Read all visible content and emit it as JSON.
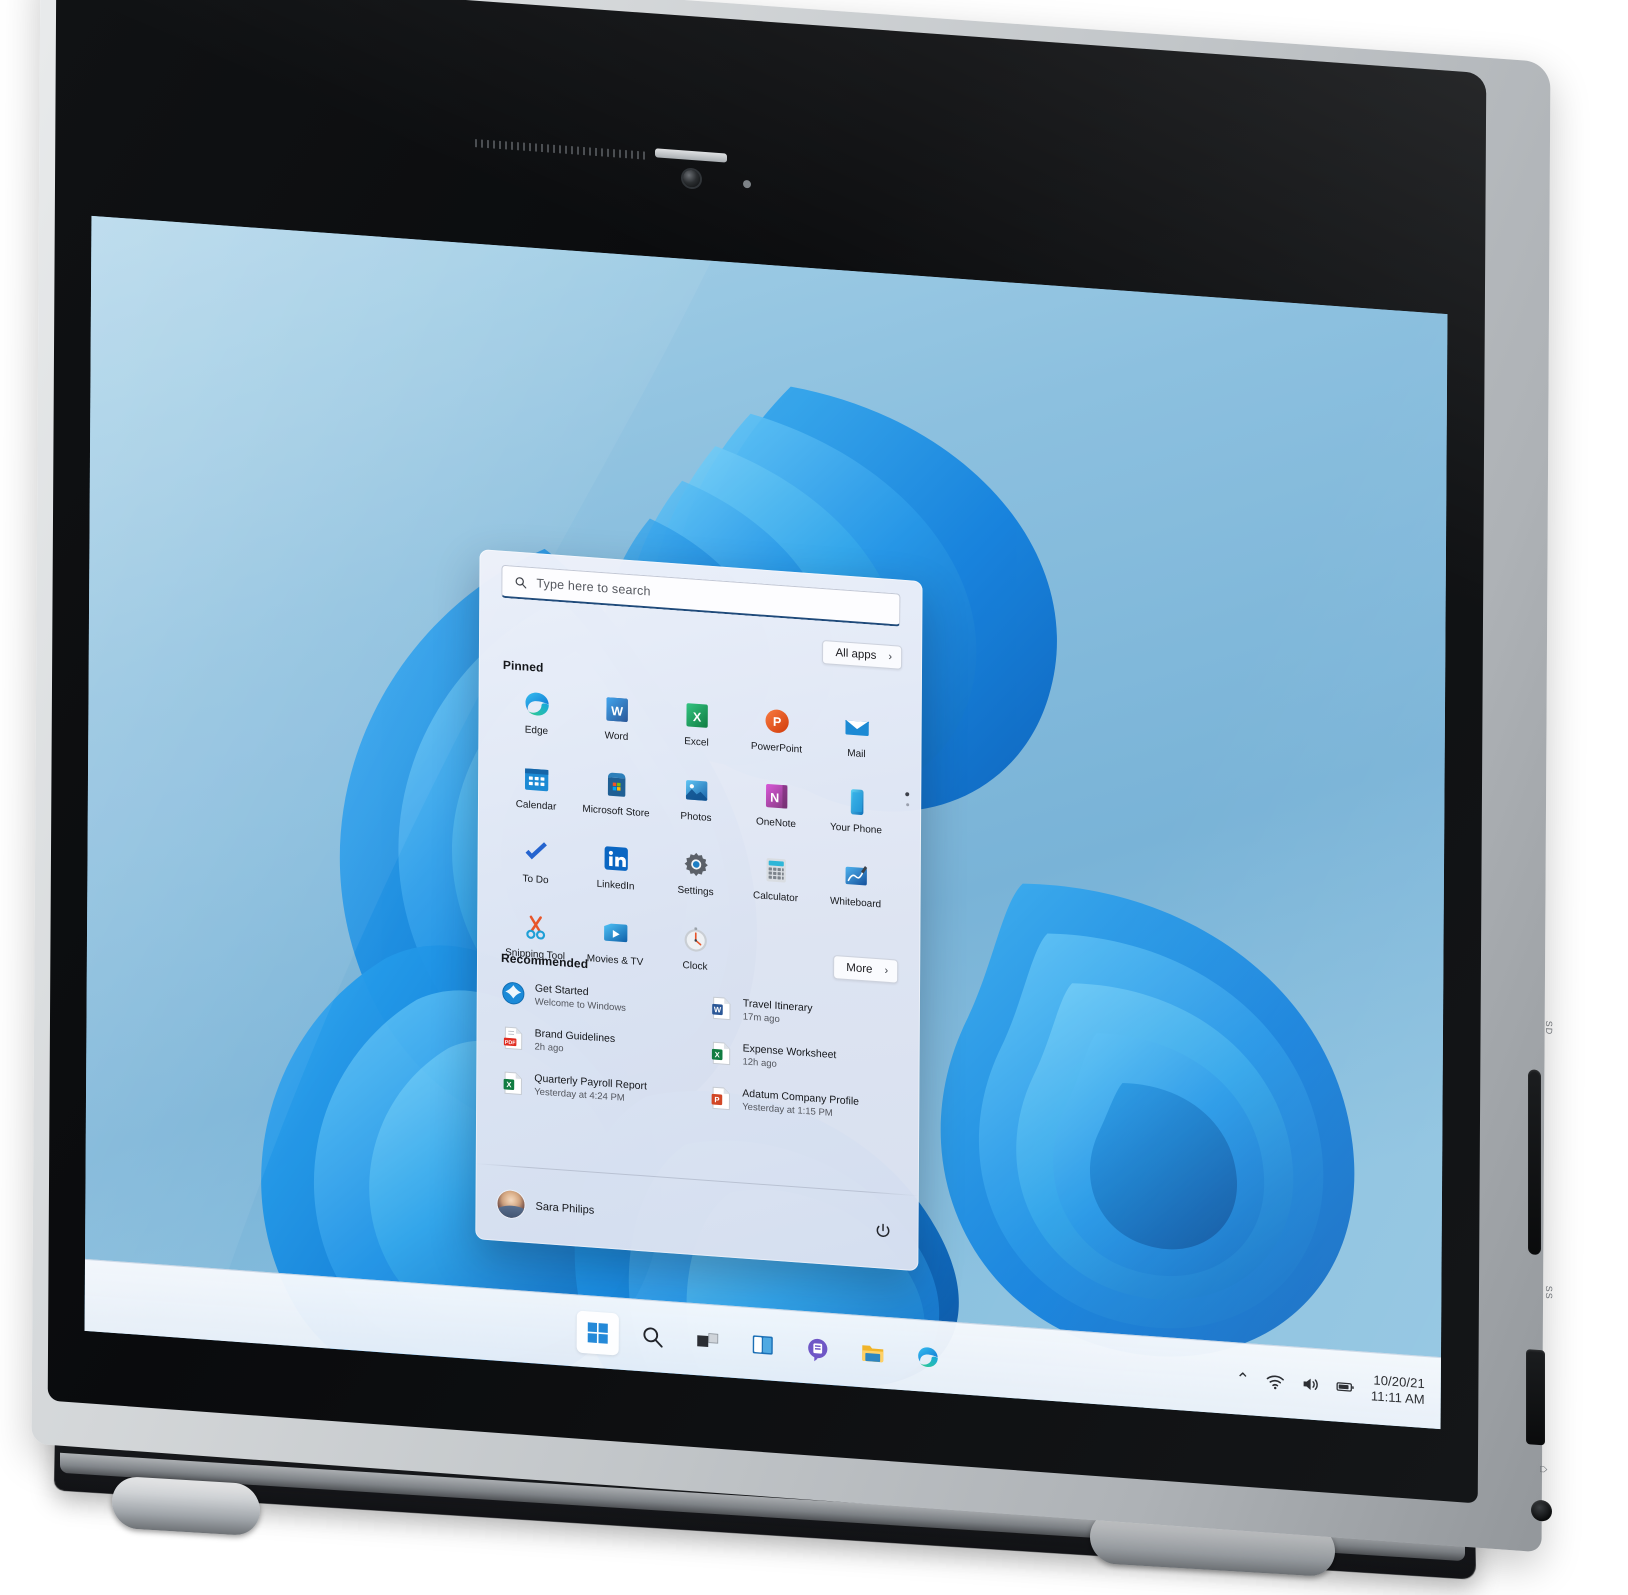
{
  "device": {
    "type": "2-in-1 convertible laptop",
    "ports": [
      {
        "name": "sd-card-slot",
        "label": "SD"
      },
      {
        "name": "usb-c-port",
        "label": "SS"
      },
      {
        "name": "headphone-jack",
        "label": "⌂"
      }
    ]
  },
  "desktop": {
    "wallpaper_name": "windows-11-bloom",
    "colors": {
      "wallpaper_sky": "#79b6d9",
      "bloom_blue": "#0a7bd6",
      "bloom_light": "#35a6ea",
      "accent": "#0067c0",
      "taskbar": "#eef3f9",
      "panel": "#e3e8f4"
    }
  },
  "start_menu": {
    "search": {
      "placeholder": "Type here to search",
      "value": "",
      "icon": "search-icon"
    },
    "all_apps_label": "All apps",
    "more_label": "More",
    "pinned_title": "Pinned",
    "recommended_title": "Recommended",
    "pinned": [
      {
        "label": "Edge",
        "icon": "edge-icon"
      },
      {
        "label": "Word",
        "icon": "word-icon"
      },
      {
        "label": "Excel",
        "icon": "excel-icon"
      },
      {
        "label": "PowerPoint",
        "icon": "powerpoint-icon"
      },
      {
        "label": "Mail",
        "icon": "mail-icon"
      },
      {
        "label": "Calendar",
        "icon": "calendar-icon"
      },
      {
        "label": "Microsoft Store",
        "icon": "microsoft-store-icon"
      },
      {
        "label": "Photos",
        "icon": "photos-icon"
      },
      {
        "label": "OneNote",
        "icon": "onenote-icon"
      },
      {
        "label": "Your Phone",
        "icon": "your-phone-icon"
      },
      {
        "label": "To Do",
        "icon": "to-do-icon"
      },
      {
        "label": "LinkedIn",
        "icon": "linkedin-icon"
      },
      {
        "label": "Settings",
        "icon": "settings-icon"
      },
      {
        "label": "Calculator",
        "icon": "calculator-icon"
      },
      {
        "label": "Whiteboard",
        "icon": "whiteboard-icon"
      },
      {
        "label": "Snipping Tool",
        "icon": "snipping-tool-icon"
      },
      {
        "label": "Movies & TV",
        "icon": "movies-tv-icon"
      },
      {
        "label": "Clock",
        "icon": "clock-icon"
      }
    ],
    "pinned_pages": {
      "current": 1,
      "total": 2
    },
    "recommended": [
      {
        "name": "Get Started",
        "sub": "Welcome to Windows",
        "icon": "get-started-icon"
      },
      {
        "name": "Travel Itinerary",
        "sub": "17m ago",
        "icon": "word-doc-icon"
      },
      {
        "name": "Brand Guidelines",
        "sub": "2h ago",
        "icon": "pdf-doc-icon"
      },
      {
        "name": "Expense Worksheet",
        "sub": "12h ago",
        "icon": "excel-doc-icon"
      },
      {
        "name": "Quarterly Payroll Report",
        "sub": "Yesterday at 4:24 PM",
        "icon": "excel-doc-icon"
      },
      {
        "name": "Adatum Company Profile",
        "sub": "Yesterday at 1:15 PM",
        "icon": "powerpoint-doc-icon"
      }
    ],
    "account": {
      "name": "Sara Philips",
      "avatar": "user-avatar"
    },
    "power_label": "Power"
  },
  "taskbar": {
    "buttons": [
      {
        "name": "start-button",
        "icon": "windows-logo-icon",
        "active": true
      },
      {
        "name": "search-button",
        "icon": "search-icon",
        "active": false
      },
      {
        "name": "task-view-button",
        "icon": "task-view-icon",
        "active": false
      },
      {
        "name": "widgets-button",
        "icon": "widgets-icon",
        "active": false
      },
      {
        "name": "chat-button",
        "icon": "chat-icon",
        "active": false
      },
      {
        "name": "file-explorer-button",
        "icon": "folder-icon",
        "active": false
      },
      {
        "name": "edge-button",
        "icon": "edge-icon",
        "active": false
      }
    ],
    "tray": {
      "show_hidden_icons": "⌃",
      "network_icon": "wifi-icon",
      "volume_icon": "speaker-icon",
      "battery_icon": "battery-icon",
      "date": "10/20/21",
      "time": "11:11 AM"
    }
  }
}
